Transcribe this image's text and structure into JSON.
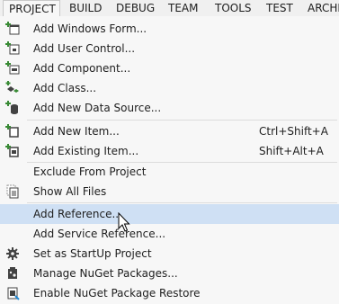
{
  "menubar": {
    "items": [
      {
        "label": "PROJECT"
      },
      {
        "label": "BUILD"
      },
      {
        "label": "DEBUG"
      },
      {
        "label": "TEAM"
      },
      {
        "label": "TOOLS"
      },
      {
        "label": "TEST"
      },
      {
        "label": "ARCHI"
      }
    ]
  },
  "menu": {
    "items": [
      {
        "label": "Add Windows Form...",
        "icon": "windows-form-icon",
        "shortcut": ""
      },
      {
        "label": "Add User Control...",
        "icon": "user-control-icon",
        "shortcut": ""
      },
      {
        "label": "Add Component...",
        "icon": "component-icon",
        "shortcut": ""
      },
      {
        "label": "Add Class...",
        "icon": "class-icon",
        "shortcut": ""
      },
      {
        "label": "Add New Data Source...",
        "icon": "data-source-icon",
        "shortcut": ""
      },
      {
        "label": "Add New Item...",
        "icon": "new-item-icon",
        "shortcut": "Ctrl+Shift+A"
      },
      {
        "label": "Add Existing Item...",
        "icon": "existing-item-icon",
        "shortcut": "Shift+Alt+A"
      },
      {
        "label": "Exclude From Project",
        "icon": "",
        "shortcut": ""
      },
      {
        "label": "Show All Files",
        "icon": "show-all-files-icon",
        "shortcut": ""
      },
      {
        "label": "Add Reference...",
        "icon": "",
        "shortcut": ""
      },
      {
        "label": "Add Service Reference...",
        "icon": "",
        "shortcut": ""
      },
      {
        "label": "Set as StartUp Project",
        "icon": "gear-icon",
        "shortcut": ""
      },
      {
        "label": "Manage NuGet Packages...",
        "icon": "nuget-icon",
        "shortcut": ""
      },
      {
        "label": "Enable NuGet Package Restore",
        "icon": "package-restore-icon",
        "shortcut": ""
      }
    ]
  },
  "colors": {
    "highlight": "#cfe0f4",
    "menu_bg": "#f7f7f7",
    "icon_green": "#388a34",
    "icon_dark": "#424242"
  }
}
